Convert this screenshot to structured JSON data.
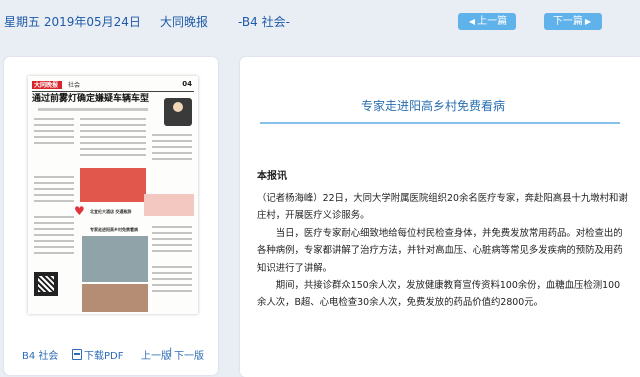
{
  "header": {
    "date": "星期五 2019年05月24日",
    "paper": "大同晚报",
    "section": "-B4 社会-",
    "prev_label": "上一篇",
    "next_label": "下一篇"
  },
  "thumbnail": {
    "logo_text": "大同晚报",
    "section": "社会",
    "page_number": "04",
    "headline": "通过前雾灯确定嫌疑车辆车型",
    "mini_captions": [
      "北宜伦大酒店 交通致辞",
      "专家走进阳高乡村免费看病"
    ],
    "footer": {
      "section": "B4 社会",
      "pdf_label": "下载PDF",
      "prev_page": "上一版",
      "separator": "|",
      "next_page": "下一版"
    }
  },
  "article": {
    "title": "专家走进阳高乡村免费看病",
    "lead": "本报讯",
    "paragraphs": [
      "（记者杨海峰）22日，大同大学附属医院组织20余名医疗专家，奔赴阳高县十九墩村和谢庄村，开展医疗义诊服务。",
      "　　当日，医疗专家耐心细致地给每位村民检查身体，并免费发放常用药品。对检查出的各种病例，专家都讲解了治疗方法，并针对高血压、心脏病等常见多发疾病的预防及用药知识进行了讲解。",
      "　　期间，共接诊群众150余人次，发放健康教育宣传资料100余份，血糖血压检测100余人次，B超、心电检查30余人次，免费发放的药品价值约2800元。"
    ]
  },
  "colors": {
    "accent": "#2a6fb0",
    "button": "#5fb2ea",
    "background": "#e9eef5"
  }
}
